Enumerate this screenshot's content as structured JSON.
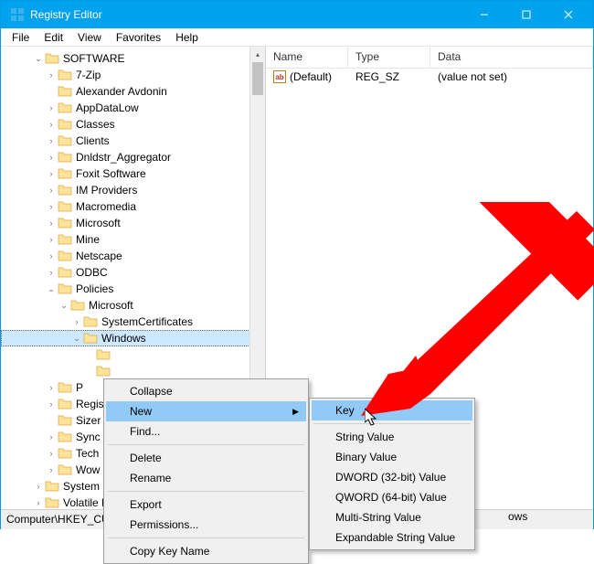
{
  "window": {
    "title": "Registry Editor"
  },
  "menubar": [
    "File",
    "Edit",
    "View",
    "Favorites",
    "Help"
  ],
  "tree": {
    "root": "SOFTWARE",
    "items": [
      {
        "label": "7-Zip",
        "exp": ">",
        "lv": 2
      },
      {
        "label": "Alexander Avdonin",
        "exp": "",
        "lv": 2
      },
      {
        "label": "AppDataLow",
        "exp": ">",
        "lv": 2
      },
      {
        "label": "Classes",
        "exp": ">",
        "lv": 2
      },
      {
        "label": "Clients",
        "exp": ">",
        "lv": 2
      },
      {
        "label": "Dnldstr_Aggregator",
        "exp": ">",
        "lv": 2
      },
      {
        "label": "Foxit Software",
        "exp": ">",
        "lv": 2
      },
      {
        "label": "IM Providers",
        "exp": ">",
        "lv": 2
      },
      {
        "label": "Macromedia",
        "exp": ">",
        "lv": 2
      },
      {
        "label": "Microsoft",
        "exp": ">",
        "lv": 2
      },
      {
        "label": "Mine",
        "exp": ">",
        "lv": 2
      },
      {
        "label": "Netscape",
        "exp": ">",
        "lv": 2
      },
      {
        "label": "ODBC",
        "exp": ">",
        "lv": 2
      },
      {
        "label": "Policies",
        "exp": "v",
        "lv": 2
      },
      {
        "label": "Microsoft",
        "exp": "v",
        "lv": 3
      },
      {
        "label": "SystemCertificates",
        "exp": ">",
        "lv": 4
      },
      {
        "label": "Windows",
        "exp": "v",
        "lv": 4,
        "sel": true
      },
      {
        "label": "",
        "exp": "",
        "lv": 5
      },
      {
        "label": "",
        "exp": "",
        "lv": 5
      },
      {
        "label": "P",
        "exp": ">",
        "lv": 2
      },
      {
        "label": "Regis",
        "exp": ">",
        "lv": 2
      },
      {
        "label": "Sizer",
        "exp": "",
        "lv": 2
      },
      {
        "label": "Sync",
        "exp": ">",
        "lv": 2
      },
      {
        "label": "Tech",
        "exp": ">",
        "lv": 2
      },
      {
        "label": "Wow",
        "exp": ">",
        "lv": 2
      },
      {
        "label": "System",
        "exp": ">",
        "lv": 1
      },
      {
        "label": "Volatile E",
        "exp": ">",
        "lv": 1
      }
    ]
  },
  "list": {
    "headers": {
      "name": "Name",
      "type": "Type",
      "data": "Data"
    },
    "rows": [
      {
        "name": "(Default)",
        "type": "REG_SZ",
        "data": "(value not set)"
      }
    ]
  },
  "context_menu": {
    "items": [
      "Collapse",
      "New",
      "Find...",
      "Delete",
      "Rename",
      "Export",
      "Permissions...",
      "Copy Key Name"
    ],
    "hover_index": 1,
    "submenu": {
      "items": [
        "Key",
        "String Value",
        "Binary Value",
        "DWORD (32-bit) Value",
        "QWORD (64-bit) Value",
        "Multi-String Value",
        "Expandable String Value"
      ],
      "hover_index": 0
    }
  },
  "statusbar": "Computer\\HKEY_CURRE",
  "statusbar_tail": "ows"
}
